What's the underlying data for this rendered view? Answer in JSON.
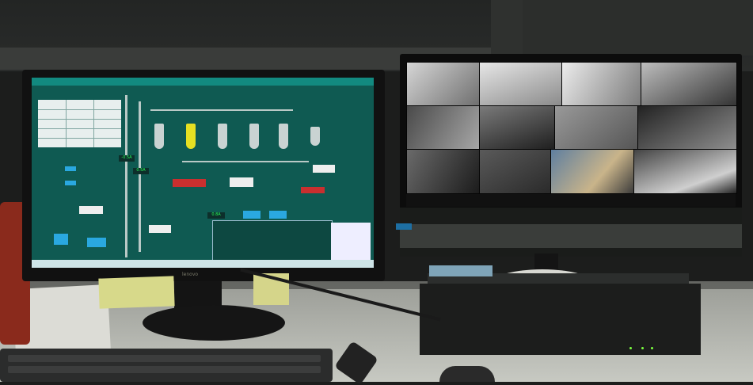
{
  "scene": "control room desk with two monitors",
  "left_monitor": {
    "brand": "lenovo",
    "screen_content": "process control diagram",
    "value_tags": [
      "-0.5A",
      "0.5A",
      "0.8A"
    ]
  },
  "right_monitor": {
    "screen_content": "surveillance camera grid"
  },
  "colors": {
    "scada_bg": "#0f5a52",
    "accent_green": "#27ff5a",
    "status_led": "#7cff3f"
  }
}
